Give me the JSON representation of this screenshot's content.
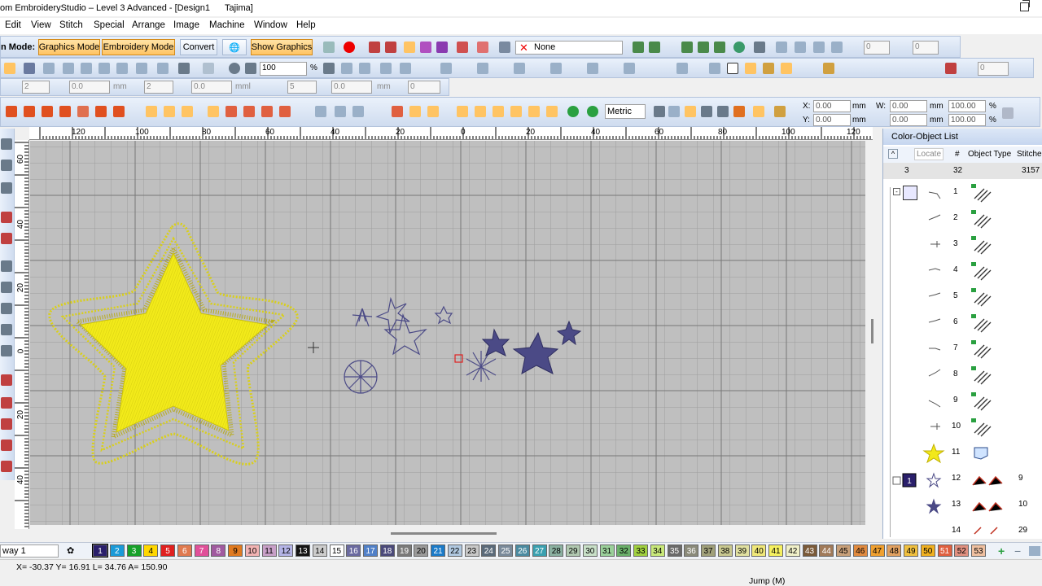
{
  "window": {
    "title": "om EmbroideryStudio – Level 3 Advanced - [Design1",
    "machine": "Tajima]"
  },
  "menu": [
    "Edit",
    "View",
    "Stitch",
    "Special",
    "Arrange",
    "Image",
    "Machine",
    "Window",
    "Help"
  ],
  "toolbar": {
    "mode_label": "n Mode:",
    "graphics_mode": "Graphics Mode",
    "embroidery_mode": "Embroidery Mode",
    "convert": "Convert",
    "show_graphics": "Show Graphics",
    "none_option": "None",
    "spin1": "0",
    "spin2": "0",
    "zoom_value": "100",
    "zoom_unit": "%",
    "metric": "Metric",
    "row3": {
      "v1": "2",
      "v2": "0.0",
      "unit_mm": "mm",
      "v3": "2",
      "v4": "0.0",
      "unit_mml": "mml",
      "v5": "5",
      "v6": "0.0",
      "unit_mm2": "mm",
      "v7": "0"
    },
    "pos": {
      "x_label": "X:",
      "x": "0.00",
      "y_label": "Y:",
      "y": "0.00",
      "w_label": "W:",
      "w": "0.00",
      "h": "0.00",
      "mm": "mm",
      "pct1": "100.00",
      "pct2": "100.00",
      "pct_unit": "%"
    },
    "right_field": "0"
  },
  "ruler": {
    "top": [
      "120",
      "100",
      "80",
      "60",
      "40",
      "20",
      "0",
      "20",
      "40",
      "60",
      "80",
      "100",
      "120"
    ],
    "left": [
      "60",
      "40",
      "20",
      "0",
      "20",
      "40"
    ]
  },
  "color_object_list": {
    "title": "Color-Object List",
    "locate": "Locate",
    "col_num": "#",
    "col_type": "Object Type",
    "col_stitches": "Stitches",
    "summary": {
      "colors": "3",
      "objects": "32",
      "stitches": "3157"
    },
    "rows": [
      {
        "num": "1",
        "stitches": ""
      },
      {
        "num": "2",
        "stitches": ""
      },
      {
        "num": "3",
        "stitches": ""
      },
      {
        "num": "4",
        "stitches": ""
      },
      {
        "num": "5",
        "stitches": ""
      },
      {
        "num": "6",
        "stitches": ""
      },
      {
        "num": "7",
        "stitches": ""
      },
      {
        "num": "8",
        "stitches": ""
      },
      {
        "num": "9",
        "stitches": ""
      },
      {
        "num": "10",
        "stitches": ""
      },
      {
        "num": "11",
        "stitches": ""
      },
      {
        "num": "12",
        "stitches": "9"
      },
      {
        "num": "13",
        "stitches": "10"
      },
      {
        "num": "14",
        "stitches": "29"
      }
    ],
    "group_badge": "1"
  },
  "palette": {
    "select_value": "way 1",
    "swatches": [
      {
        "n": "1",
        "c": "#2a1f6b",
        "t": "#fff"
      },
      {
        "n": "2",
        "c": "#1a9ad8",
        "t": "#fff"
      },
      {
        "n": "3",
        "c": "#16a12a",
        "t": "#fff"
      },
      {
        "n": "4",
        "c": "#ffd700",
        "t": "#000"
      },
      {
        "n": "5",
        "c": "#e02020",
        "t": "#fff"
      },
      {
        "n": "6",
        "c": "#e07a50",
        "t": "#fff"
      },
      {
        "n": "7",
        "c": "#e0509a",
        "t": "#fff"
      },
      {
        "n": "8",
        "c": "#a05aa0",
        "t": "#fff"
      },
      {
        "n": "9",
        "c": "#e07a20",
        "t": "#000"
      },
      {
        "n": "10",
        "c": "#f2b3b3",
        "t": "#000"
      },
      {
        "n": "11",
        "c": "#c8a0c8",
        "t": "#000"
      },
      {
        "n": "12",
        "c": "#b4b4e6",
        "t": "#000"
      },
      {
        "n": "13",
        "c": "#141414",
        "t": "#fff"
      },
      {
        "n": "14",
        "c": "#cccccc",
        "t": "#000"
      },
      {
        "n": "15",
        "c": "#ffffff",
        "t": "#000"
      },
      {
        "n": "16",
        "c": "#6a6aa0",
        "t": "#fff"
      },
      {
        "n": "17",
        "c": "#5080c8",
        "t": "#fff"
      },
      {
        "n": "18",
        "c": "#4a4a7a",
        "t": "#fff"
      },
      {
        "n": "19",
        "c": "#7a7a7a",
        "t": "#fff"
      },
      {
        "n": "20",
        "c": "#9a9a9a",
        "t": "#000"
      },
      {
        "n": "21",
        "c": "#1a7ac8",
        "t": "#fff"
      },
      {
        "n": "22",
        "c": "#b0c8e0",
        "t": "#000"
      },
      {
        "n": "23",
        "c": "#c8c8c8",
        "t": "#000"
      },
      {
        "n": "24",
        "c": "#5a6a7a",
        "t": "#fff"
      },
      {
        "n": "25",
        "c": "#7a8a9a",
        "t": "#fff"
      },
      {
        "n": "26",
        "c": "#4a8aa0",
        "t": "#fff"
      },
      {
        "n": "27",
        "c": "#3aa0b0",
        "t": "#fff"
      },
      {
        "n": "28",
        "c": "#8ab0a0",
        "t": "#000"
      },
      {
        "n": "29",
        "c": "#b0c8b0",
        "t": "#000"
      },
      {
        "n": "30",
        "c": "#c8e0c8",
        "t": "#000"
      },
      {
        "n": "31",
        "c": "#9ad09a",
        "t": "#000"
      },
      {
        "n": "32",
        "c": "#6ab06a",
        "t": "#000"
      },
      {
        "n": "33",
        "c": "#a0d040",
        "t": "#000"
      },
      {
        "n": "34",
        "c": "#c8e87a",
        "t": "#000"
      },
      {
        "n": "35",
        "c": "#6a6a6a",
        "t": "#fff"
      },
      {
        "n": "36",
        "c": "#8a8a7a",
        "t": "#fff"
      },
      {
        "n": "37",
        "c": "#a0a07a",
        "t": "#000"
      },
      {
        "n": "38",
        "c": "#c8c890",
        "t": "#000"
      },
      {
        "n": "39",
        "c": "#e0e0a0",
        "t": "#000"
      },
      {
        "n": "40",
        "c": "#f0e87a",
        "t": "#000"
      },
      {
        "n": "41",
        "c": "#f5f060",
        "t": "#000"
      },
      {
        "n": "42",
        "c": "#f0f0c8",
        "t": "#000"
      },
      {
        "n": "43",
        "c": "#7a5a3a",
        "t": "#fff"
      },
      {
        "n": "44",
        "c": "#a07a5a",
        "t": "#fff"
      },
      {
        "n": "45",
        "c": "#c8a07a",
        "t": "#000"
      },
      {
        "n": "46",
        "c": "#e08a40",
        "t": "#000"
      },
      {
        "n": "47",
        "c": "#f0a030",
        "t": "#000"
      },
      {
        "n": "48",
        "c": "#e0a060",
        "t": "#000"
      },
      {
        "n": "49",
        "c": "#f0c040",
        "t": "#000"
      },
      {
        "n": "50",
        "c": "#f0b020",
        "t": "#000"
      },
      {
        "n": "51",
        "c": "#e06040",
        "t": "#fff"
      },
      {
        "n": "52",
        "c": "#e09080",
        "t": "#000"
      },
      {
        "n": "53",
        "c": "#f0c0a0",
        "t": "#000"
      }
    ]
  },
  "status": {
    "coords": "X= -30.37 Y=  16.91 L=  34.76 A= 150.90",
    "jump": "Jump (M)"
  },
  "colors": {
    "fill_yellow": "#f2ea1a",
    "stitch_purple": "#4b4a86"
  }
}
